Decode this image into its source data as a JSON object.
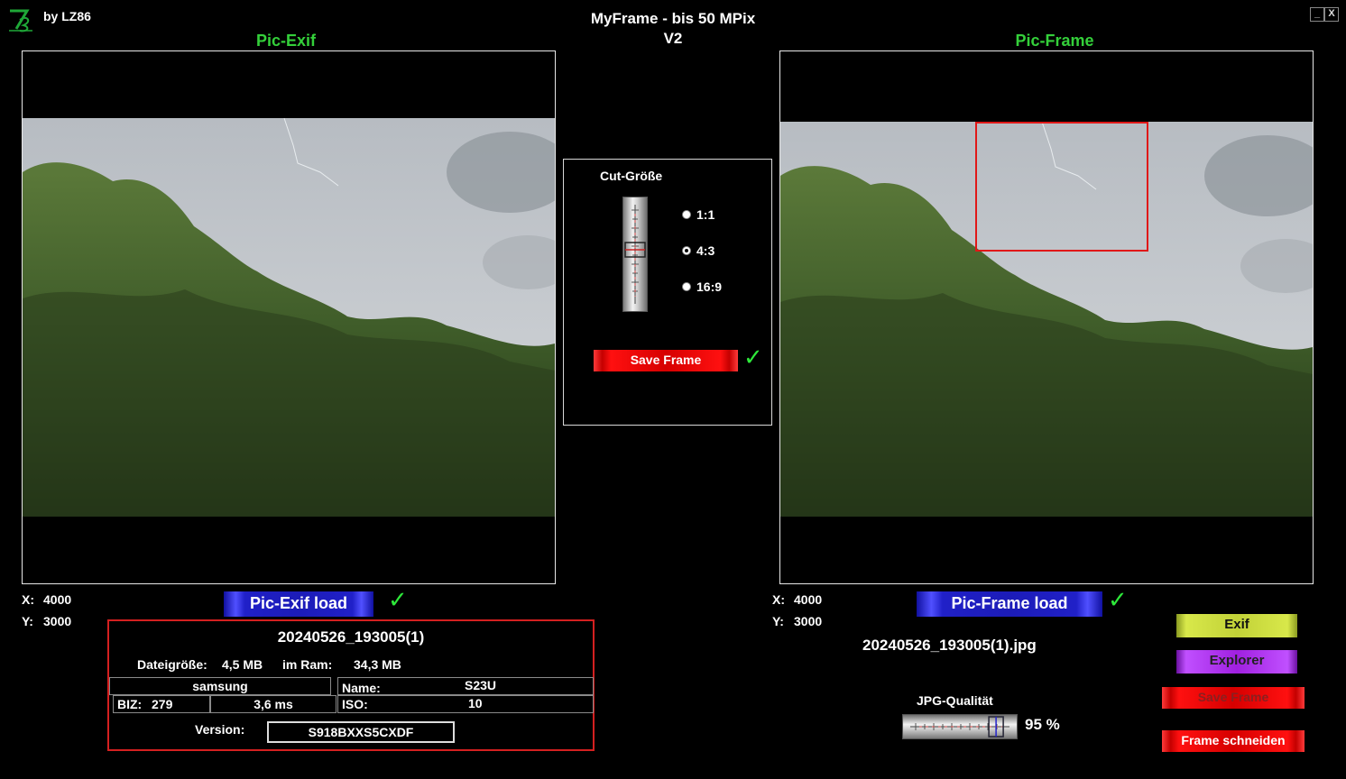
{
  "app": {
    "brand": "by LZ86",
    "title_line1": "MyFrame - bis 50 MPix",
    "title_line2": "V2",
    "minimize": "_",
    "close": "X"
  },
  "left_panel": {
    "title": "Pic-Exif",
    "x_label": "X:",
    "x_value": "4000",
    "y_label": "Y:",
    "y_value": "3000",
    "load_button": "Pic-Exif load"
  },
  "right_panel": {
    "title": "Pic-Frame",
    "x_label": "X:",
    "x_value": "4000",
    "y_label": "Y:",
    "y_value": "3000",
    "load_button": "Pic-Frame load",
    "filename": "20240526_193005(1).jpg"
  },
  "cut": {
    "title": "Cut-Größe",
    "options": [
      "1:1",
      "4:3",
      "16:9"
    ],
    "selected": "4:3",
    "save_button": "Save Frame"
  },
  "info": {
    "filename": "20240526_193005(1)",
    "size_label": "Dateigröße:",
    "size_value": "4,5 MB",
    "ram_label": "im Ram:",
    "ram_value": "34,3 MB",
    "make": "samsung",
    "name_label": "Name:",
    "name_value": "S23U",
    "biz_label": "BIZ:",
    "biz_value": "279",
    "exposure": "3,6 ms",
    "iso_label": "ISO:",
    "iso_value": "10",
    "version_label": "Version:",
    "version_value": "S918BXXS5CXDF"
  },
  "right_buttons": {
    "exif": "Exif",
    "explorer": "Explorer",
    "save_frame": "Save Frame",
    "cut_frame": "Frame schneiden"
  },
  "quality": {
    "label": "JPG-Qualität",
    "value": "95 %",
    "level_percent": 95
  },
  "check_glyph": "✓"
}
